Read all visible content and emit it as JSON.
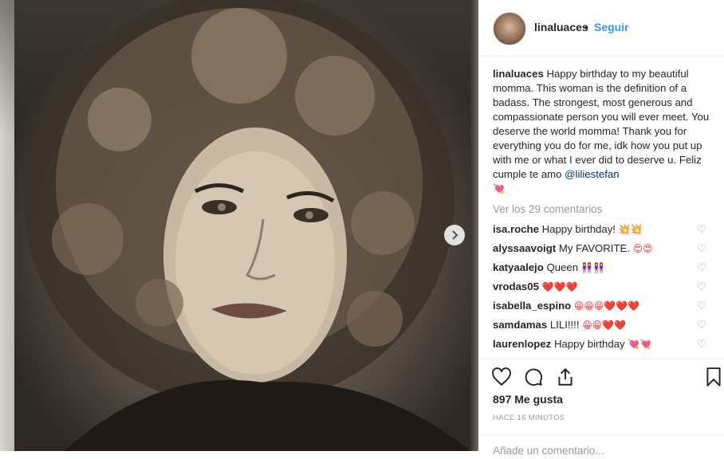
{
  "post": {
    "next_symbol": "›"
  },
  "header": {
    "username": "linaluaces",
    "dot": "•",
    "follow_label": "Seguir"
  },
  "caption": {
    "username": "linaluaces",
    "text": "Happy birthday to my beautiful momma. This woman is the definition of a badass. The strongest, most generous and compassionate person you will ever meet. You deserve the world momma! Thank you for everything you do for me, idk how you put up with me or what I ever did to deserve u. Feliz cumple te amo",
    "mention": "@liliestefan",
    "emoji": "💘"
  },
  "view_all_comments": "Ver los 29 comentarios",
  "comments": [
    {
      "user": "isa.roche",
      "text": "Happy birthday!",
      "emoji": "💥💥"
    },
    {
      "user": "alyssaavoigt",
      "text": "My FAVORITE.",
      "emoji": "😍😍"
    },
    {
      "user": "katyaalejo",
      "text": "Queen",
      "emoji": "👭👭"
    },
    {
      "user": "vrodas05",
      "text": "",
      "emoji": "❤️❤️❤️"
    },
    {
      "user": "isabella_espino",
      "text": "",
      "emoji": "😁😁😁❤️❤️❤️"
    },
    {
      "user": "samdamas",
      "text": "LILI!!!!",
      "emoji": "😁😁❤️❤️"
    },
    {
      "user": "laurenlopez",
      "text": "Happy birthday",
      "emoji": "💘💘"
    }
  ],
  "actions": {
    "like_icon": "heart-icon",
    "comment_icon": "comment-icon",
    "share_icon": "share-icon",
    "save_icon": "bookmark-icon"
  },
  "likes": "897 Me gusta",
  "timestamp": "HACE 16 MINUTOS",
  "add_comment_placeholder": "Añade un comentario..."
}
